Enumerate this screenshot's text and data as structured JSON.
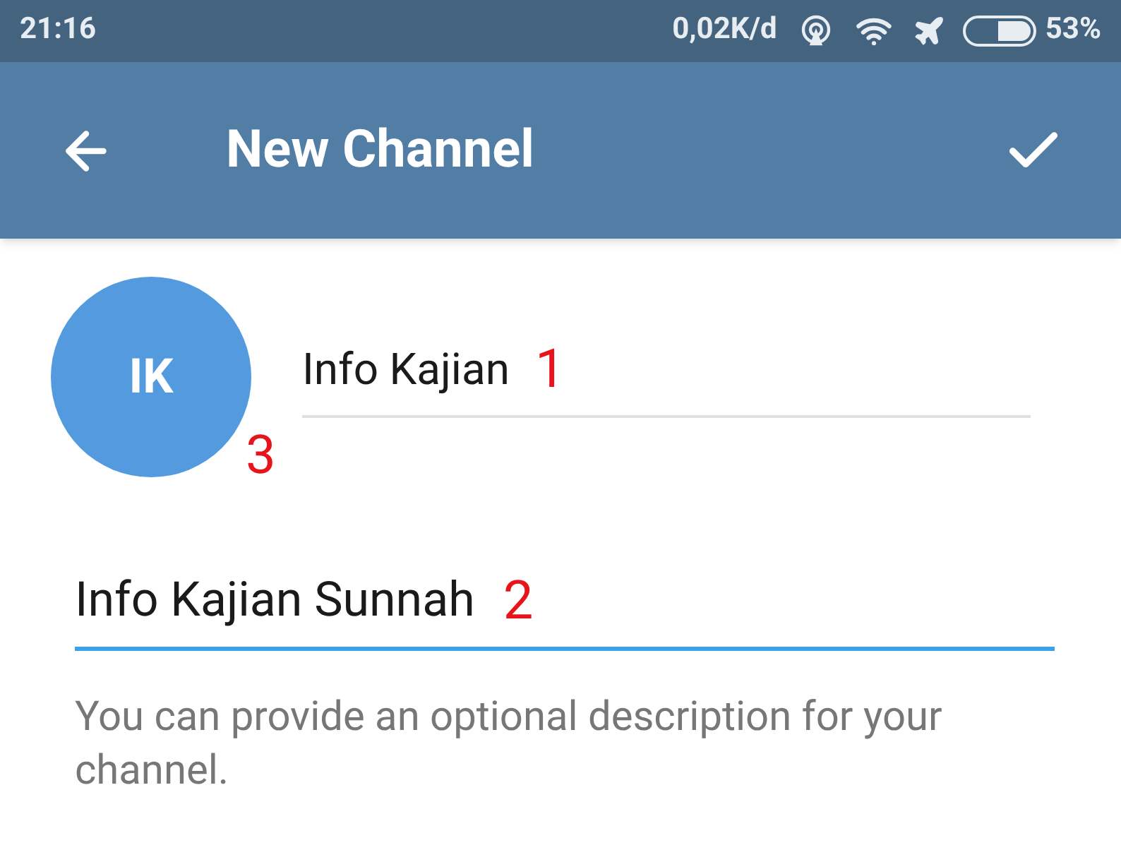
{
  "status_bar": {
    "time": "21:16",
    "speed": "0,02K/d",
    "battery": {
      "level": 0.53
    },
    "battery_text": "53%"
  },
  "app_bar": {
    "title": "New Channel"
  },
  "avatar": {
    "initials": "IK",
    "color": "#539ade"
  },
  "name_field": {
    "value": "Info Kajian",
    "focused": false
  },
  "description_field": {
    "value": "Info Kajian Sunnah",
    "focused": true
  },
  "hint": "You can provide an optional description for your channel.",
  "annotations": [
    "1",
    "2",
    "3"
  ]
}
